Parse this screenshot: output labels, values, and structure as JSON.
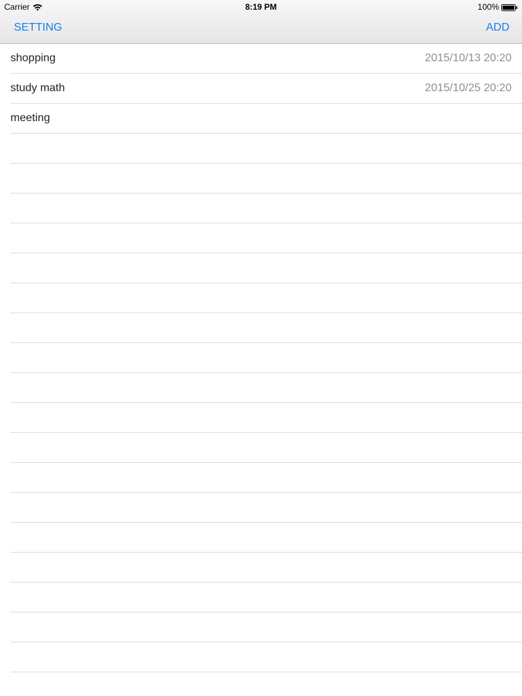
{
  "status_bar": {
    "carrier": "Carrier",
    "time": "8:19 PM",
    "battery": "100%",
    "wifi_icon": "wifi-icon",
    "battery_icon": "battery-icon"
  },
  "nav": {
    "left_label": "SETTING",
    "right_label": "ADD",
    "accent_color": "#1a7ee6"
  },
  "tasks": [
    {
      "title": "shopping",
      "date": "2015/10/13 20:20"
    },
    {
      "title": "study math",
      "date": "2015/10/25 20:20"
    },
    {
      "title": "meeting",
      "date": ""
    },
    {
      "title": "",
      "date": ""
    },
    {
      "title": "",
      "date": ""
    },
    {
      "title": "",
      "date": ""
    },
    {
      "title": "",
      "date": ""
    },
    {
      "title": "",
      "date": ""
    },
    {
      "title": "",
      "date": ""
    },
    {
      "title": "",
      "date": ""
    },
    {
      "title": "",
      "date": ""
    },
    {
      "title": "",
      "date": ""
    },
    {
      "title": "",
      "date": ""
    },
    {
      "title": "",
      "date": ""
    },
    {
      "title": "",
      "date": ""
    },
    {
      "title": "",
      "date": ""
    },
    {
      "title": "",
      "date": ""
    },
    {
      "title": "",
      "date": ""
    },
    {
      "title": "",
      "date": ""
    },
    {
      "title": "",
      "date": ""
    },
    {
      "title": "",
      "date": ""
    }
  ]
}
